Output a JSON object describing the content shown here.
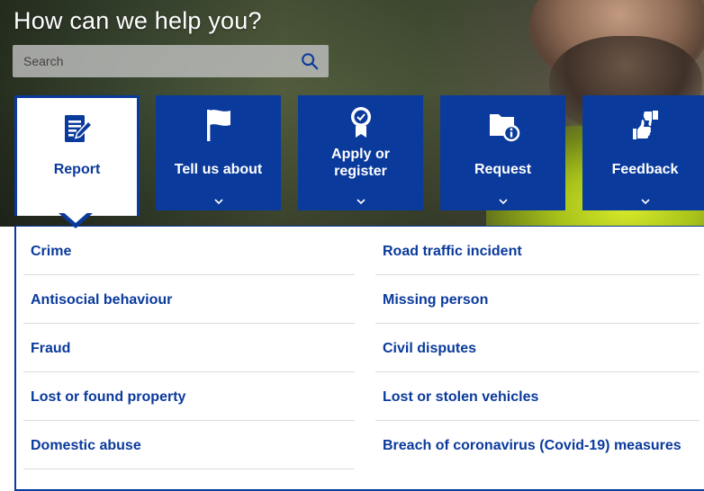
{
  "hero": {
    "title": "How can we help you?"
  },
  "search": {
    "placeholder": "Search",
    "value": ""
  },
  "tiles": [
    {
      "label": "Report",
      "icon": "report-form-icon",
      "active": true
    },
    {
      "label": "Tell us about",
      "icon": "flag-icon",
      "active": false
    },
    {
      "label": "Apply or register",
      "icon": "award-badge-icon",
      "active": false
    },
    {
      "label": "Request",
      "icon": "folder-info-icon",
      "active": false
    },
    {
      "label": "Feedback",
      "icon": "thumbs-up-down-icon",
      "active": false
    }
  ],
  "menu": {
    "left": [
      "Crime",
      "Antisocial behaviour",
      "Fraud",
      "Lost or found property",
      "Domestic abuse"
    ],
    "right": [
      "Road traffic incident",
      "Missing person",
      "Civil disputes",
      "Lost or stolen vehicles",
      "Breach of coronavirus (Covid-19) measures"
    ]
  },
  "colors": {
    "brand_blue": "#0a3a9c",
    "white": "#ffffff"
  }
}
